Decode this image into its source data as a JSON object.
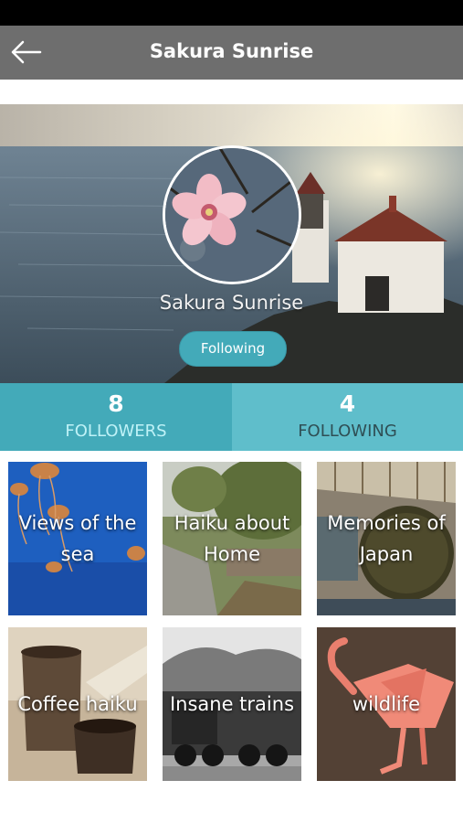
{
  "header": {
    "title": "Sakura Sunrise",
    "back_icon": "back-arrow-icon"
  },
  "profile": {
    "name": "Sakura Sunrise",
    "follow_button_label": "Following",
    "avatar": "cherry-blossom-photo"
  },
  "stats": {
    "followers": {
      "count": "8",
      "label": "FOLLOWERS"
    },
    "following": {
      "count": "4",
      "label": "FOLLOWING"
    }
  },
  "collections": [
    {
      "title": "Views of the sea"
    },
    {
      "title": "Haiku about Home"
    },
    {
      "title": "Memories of Japan"
    },
    {
      "title": "Coffee haiku"
    },
    {
      "title": "Insane trains"
    },
    {
      "title": "wildlife"
    }
  ],
  "colors": {
    "nav_bar": "#6e6e6e",
    "accent": "#43aab9",
    "accent_light": "#5fbecb"
  }
}
